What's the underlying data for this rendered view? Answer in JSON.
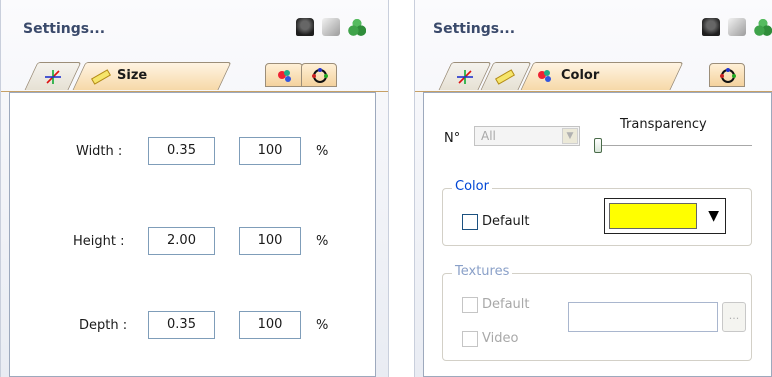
{
  "left_panel": {
    "title": "Settings...",
    "active_tab": "Size",
    "rows": [
      {
        "label": "Width :",
        "value": "0.35",
        "percent": "100",
        "unit": "%"
      },
      {
        "label": "Height :",
        "value": "2.00",
        "percent": "100",
        "unit": "%"
      },
      {
        "label": "Depth :",
        "value": "0.35",
        "percent": "100",
        "unit": "%"
      }
    ]
  },
  "right_panel": {
    "title": "Settings...",
    "active_tab": "Color",
    "number_label": "N°",
    "number_value": "All",
    "transparency_label": "Transparency",
    "transparency_level": 0.0,
    "color_group": {
      "title": "Color",
      "default_label": "Default",
      "default_checked": false,
      "selected_color": "#ffff00"
    },
    "textures_group": {
      "title": "Textures",
      "default_label": "Default",
      "video_label": "Video",
      "browse_label": "..."
    }
  },
  "colors": {
    "tab_active": "#f6d9a8",
    "group_title": "#0046d5",
    "header_text": "#3a4a6b"
  }
}
